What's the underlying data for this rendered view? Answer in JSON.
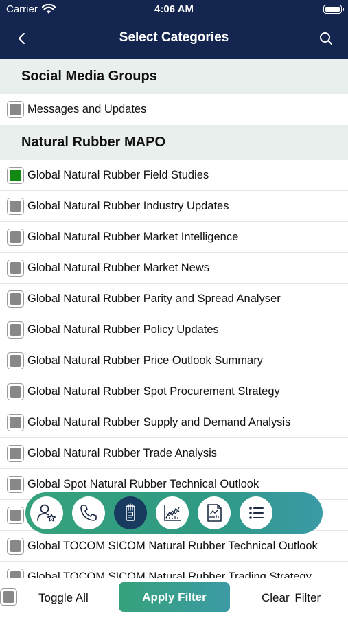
{
  "status_bar": {
    "carrier": "Carrier",
    "time": "4:06 AM"
  },
  "nav": {
    "title": "Select Categories"
  },
  "sections": [
    {
      "title": "Social Media Groups",
      "items": [
        {
          "label": "Messages and Updates",
          "checked": false
        }
      ]
    },
    {
      "title": "Natural Rubber MAPO",
      "items": [
        {
          "label": "Global Natural Rubber Field Studies",
          "checked": true
        },
        {
          "label": "Global Natural Rubber Industry Updates",
          "checked": false
        },
        {
          "label": "Global Natural Rubber Market Intelligence",
          "checked": false
        },
        {
          "label": "Global Natural Rubber Market News",
          "checked": false
        },
        {
          "label": "Global Natural Rubber Parity and Spread Analyser",
          "checked": false
        },
        {
          "label": "Global Natural Rubber Policy Updates",
          "checked": false
        },
        {
          "label": "Global Natural Rubber Price Outlook Summary",
          "checked": false
        },
        {
          "label": "Global Natural Rubber Spot Procurement Strategy",
          "checked": false
        },
        {
          "label": "Global Natural Rubber Supply and Demand Analysis",
          "checked": false
        },
        {
          "label": "Global Natural Rubber Trade Analysis",
          "checked": false
        },
        {
          "label": "Global Spot Natural Rubber Technical Outlook",
          "checked": false
        },
        {
          "label": "",
          "checked": false
        },
        {
          "label": "Global TOCOM SICOM Natural Rubber Technical Outlook",
          "checked": false
        },
        {
          "label": "Global TOCOM SICOM Natural Rubber Trading Strategy",
          "checked": false
        }
      ]
    }
  ],
  "action_bar": {
    "icons": [
      "user-star-icon",
      "phone-icon",
      "sms-icon",
      "line-chart-icon",
      "report-icon",
      "list-icon"
    ],
    "active_index": 2
  },
  "bottom": {
    "toggle_all_label": "Toggle All",
    "apply_label": "Apply Filter",
    "clear_label": "Clear Filter"
  },
  "colors": {
    "header": "#142650",
    "section_bg": "#e8efec",
    "checked": "#128a12",
    "unchecked": "#888888",
    "accent": "#36a27c"
  }
}
